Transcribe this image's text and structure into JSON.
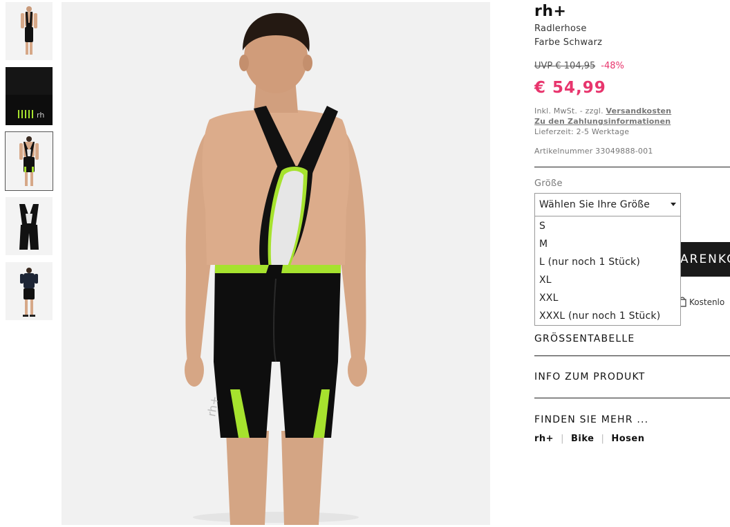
{
  "gallery": {
    "thumbnails": [
      {
        "label": "front-view",
        "selected": false
      },
      {
        "label": "detail-leg-logo",
        "selected": false
      },
      {
        "label": "back-view",
        "selected": true
      },
      {
        "label": "flat-product",
        "selected": false
      },
      {
        "label": "model-with-shirt",
        "selected": false
      }
    ]
  },
  "product": {
    "brand": "rh+",
    "name": "Radlerhose",
    "color": "Farbe Schwarz",
    "uvp_label": "UVP € 104,95",
    "discount": "-48%",
    "price": "€ 54,99",
    "tax_prefix": "Inkl. MwSt. - zzgl.",
    "shipping_link": "Versandkosten",
    "payment_link": "Zu den Zahlungsinformationen",
    "delivery": "Lieferzeit: 2-5 Werktage",
    "article_number": "Artikelnummer 33049888-001"
  },
  "size": {
    "label": "Größe",
    "placeholder": "Wählen Sie Ihre Größe",
    "options": [
      "S",
      "M",
      "L (nur noch 1 Stück)",
      "XL",
      "XXL",
      "XXXL (nur noch 1 Stück)"
    ]
  },
  "cart": {
    "button_label": "ARENKO",
    "shipping_note": "Kostenlo"
  },
  "accordion": {
    "size_table": "GRÖSSENTABELLE",
    "product_info": "INFO ZUM PRODUKT",
    "find_more": "FINDEN SIE MEHR ..."
  },
  "tags": [
    "rh+",
    "Bike",
    "Hosen"
  ],
  "colors": {
    "accent": "#e8356d",
    "lime": "#a6e22e",
    "black": "#111111"
  }
}
